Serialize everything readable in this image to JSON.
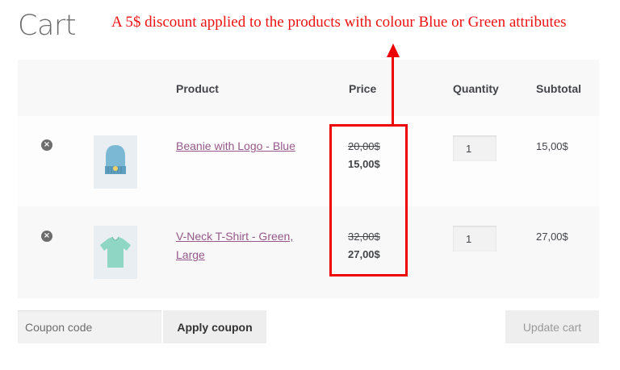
{
  "page": {
    "title": "Cart"
  },
  "annotation": {
    "text": "A 5$ discount applied to the products with colour Blue or Green attributes",
    "color": "#ee1111"
  },
  "table": {
    "headers": {
      "product": "Product",
      "price": "Price",
      "quantity": "Quantity",
      "subtotal": "Subtotal"
    },
    "rows": [
      {
        "remove_icon": "remove-circle-icon",
        "image": "beanie-blue-image",
        "product": "Beanie with Logo - Blue",
        "price_original": "20,00$",
        "price_discounted": "15,00$",
        "quantity": "1",
        "subtotal": "15,00$"
      },
      {
        "remove_icon": "remove-circle-icon",
        "image": "vneck-tshirt-green-image",
        "product": "V-Neck T-Shirt - Green, Large",
        "price_original": "32,00$",
        "price_discounted": "27,00$",
        "quantity": "1",
        "subtotal": "27,00$"
      }
    ]
  },
  "actions": {
    "coupon_placeholder": "Coupon code",
    "apply_coupon": "Apply coupon",
    "update_cart": "Update cart"
  },
  "colors": {
    "link": "#96588a",
    "annotation_red": "#ee0000",
    "text": "#43454b"
  }
}
